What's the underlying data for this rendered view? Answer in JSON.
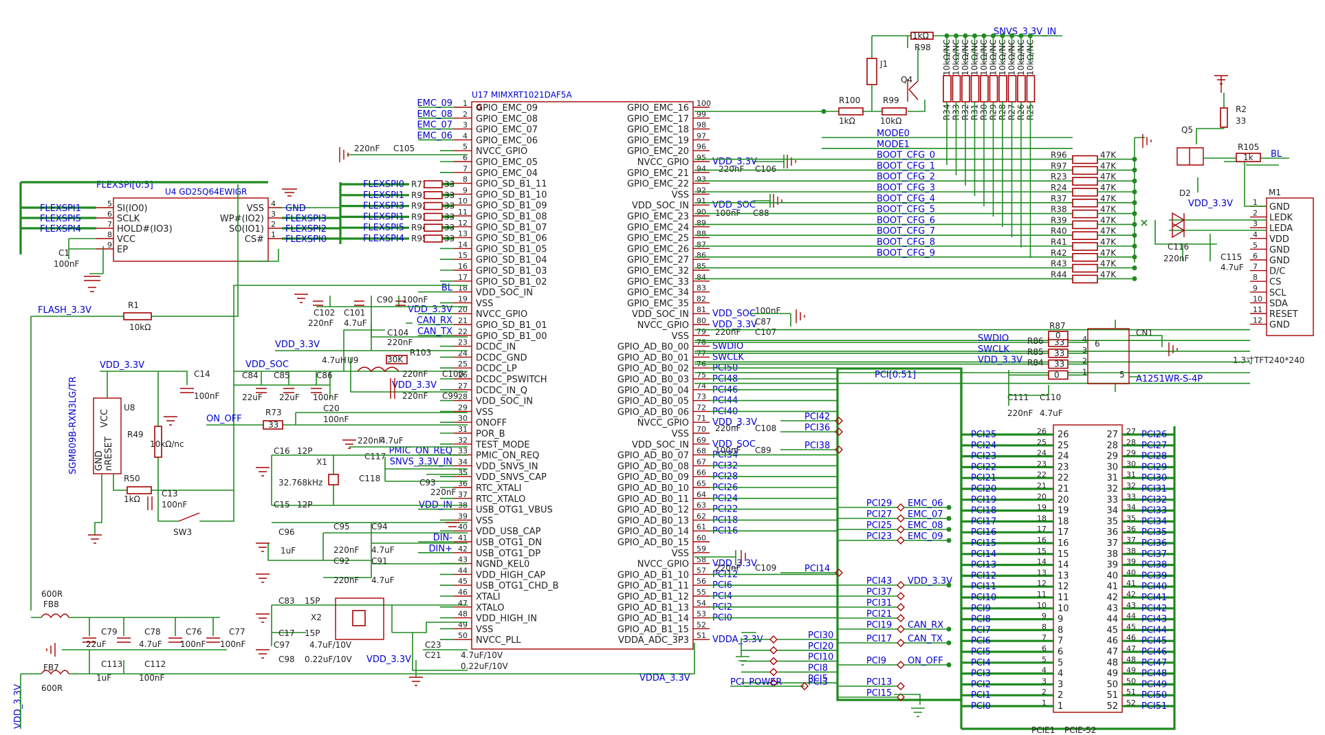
{
  "u17": {
    "name": "U17 MIMXRT1021DAF5A",
    "left": [
      {
        "n": "1",
        "s": "GPIO_EMC_09"
      },
      {
        "n": "2",
        "s": "GPIO_EMC_08"
      },
      {
        "n": "3",
        "s": "GPIO_EMC_07"
      },
      {
        "n": "4",
        "s": "GPIO_EMC_06"
      },
      {
        "n": "5",
        "s": "NVCC_GPIO"
      },
      {
        "n": "6",
        "s": "GPIO_EMC_05"
      },
      {
        "n": "7",
        "s": "GPIO_EMC_04"
      },
      {
        "n": "8",
        "s": "GPIO_SD_B1_11"
      },
      {
        "n": "9",
        "s": "GPIO_SD_B1_10"
      },
      {
        "n": "10",
        "s": "GPIO_SD_B1_09"
      },
      {
        "n": "11",
        "s": "GPIO_SD_B1_08"
      },
      {
        "n": "12",
        "s": "GPIO_SD_B1_07"
      },
      {
        "n": "13",
        "s": "GPIO_SD_B1_06"
      },
      {
        "n": "14",
        "s": "GPIO_SD_B1_05"
      },
      {
        "n": "15",
        "s": "GPIO_SD_B1_04"
      },
      {
        "n": "16",
        "s": "GPIO_SD_B1_03"
      },
      {
        "n": "17",
        "s": "GPIO_SD_B1_02"
      },
      {
        "n": "18",
        "s": "VDD_SOC_IN"
      },
      {
        "n": "19",
        "s": "VSS"
      },
      {
        "n": "20",
        "s": "NVCC_GPIO"
      },
      {
        "n": "21",
        "s": "GPIO_SD_B1_01"
      },
      {
        "n": "22",
        "s": "GPIO_SD_B1_00"
      },
      {
        "n": "23",
        "s": "DCDC_IN"
      },
      {
        "n": "24",
        "s": "DCDC_GND"
      },
      {
        "n": "25",
        "s": "DCDC_LP"
      },
      {
        "n": "26",
        "s": "DCDC_PSWITCH"
      },
      {
        "n": "27",
        "s": "DCDC_IN_Q"
      },
      {
        "n": "28",
        "s": "VDD_SOC_IN"
      },
      {
        "n": "29",
        "s": "VSS"
      },
      {
        "n": "30",
        "s": "ONOFF"
      },
      {
        "n": "31",
        "s": "POR_B"
      },
      {
        "n": "32",
        "s": "TEST_MODE"
      },
      {
        "n": "33",
        "s": "PMIC_ON_REQ"
      },
      {
        "n": "34",
        "s": "VDD_SNVS_IN"
      },
      {
        "n": "35",
        "s": "VDD_SNVS_CAP"
      },
      {
        "n": "36",
        "s": "RTC_XTALI"
      },
      {
        "n": "37",
        "s": "RTC_XTALO"
      },
      {
        "n": "38",
        "s": "USB_OTG1_VBUS"
      },
      {
        "n": "39",
        "s": "VSS"
      },
      {
        "n": "40",
        "s": "VDD_USB_CAP"
      },
      {
        "n": "41",
        "s": "USB_OTG1_DN"
      },
      {
        "n": "42",
        "s": "USB_OTG1_DP"
      },
      {
        "n": "43",
        "s": "NGND_KEL0"
      },
      {
        "n": "44",
        "s": "VDD_HIGH_CAP"
      },
      {
        "n": "45",
        "s": "USB_OTG1_CHD_B"
      },
      {
        "n": "46",
        "s": "XTALI"
      },
      {
        "n": "47",
        "s": "XTALO"
      },
      {
        "n": "48",
        "s": "VDD_HIGH_IN"
      },
      {
        "n": "49",
        "s": "VSS"
      },
      {
        "n": "50",
        "s": "NVCC_PLL"
      }
    ],
    "right": [
      {
        "n": "100",
        "s": "GPIO_EMC_16"
      },
      {
        "n": "99",
        "s": "GPIO_EMC_17"
      },
      {
        "n": "98",
        "s": "GPIO_EMC_18"
      },
      {
        "n": "97",
        "s": "GPIO_EMC_19"
      },
      {
        "n": "96",
        "s": "GPIO_EMC_20"
      },
      {
        "n": "95",
        "s": "NVCC_GPIO"
      },
      {
        "n": "94",
        "s": "GPIO_EMC_21"
      },
      {
        "n": "93",
        "s": "GPIO_EMC_22"
      },
      {
        "n": "92",
        "s": "VSS"
      },
      {
        "n": "91",
        "s": "VDD_SOC_IN"
      },
      {
        "n": "90",
        "s": "GPIO_EMC_23"
      },
      {
        "n": "89",
        "s": "GPIO_EMC_24"
      },
      {
        "n": "88",
        "s": "GPIO_EMC_25"
      },
      {
        "n": "87",
        "s": "GPIO_EMC_26"
      },
      {
        "n": "86",
        "s": "GPIO_EMC_27"
      },
      {
        "n": "85",
        "s": "GPIO_EMC_32"
      },
      {
        "n": "84",
        "s": "GPIO_EMC_33"
      },
      {
        "n": "83",
        "s": "GPIO_EMC_34"
      },
      {
        "n": "82",
        "s": "GPIO_EMC_35"
      },
      {
        "n": "81",
        "s": "VDD_SOC_IN"
      },
      {
        "n": "80",
        "s": "NVCC_GPIO"
      },
      {
        "n": "79",
        "s": "VSS"
      },
      {
        "n": "78",
        "s": "GPIO_AD_B0_00"
      },
      {
        "n": "77",
        "s": "GPIO_AD_B0_01"
      },
      {
        "n": "76",
        "s": "GPIO_AD_B0_02"
      },
      {
        "n": "75",
        "s": "GPIO_AD_B0_03"
      },
      {
        "n": "74",
        "s": "GPIO_AD_B0_04"
      },
      {
        "n": "73",
        "s": "GPIO_AD_B0_05"
      },
      {
        "n": "72",
        "s": "GPIO_AD_B0_06"
      },
      {
        "n": "71",
        "s": "NVCC_GPIO"
      },
      {
        "n": "70",
        "s": "VSS"
      },
      {
        "n": "69",
        "s": "VDD_SOC_IN"
      },
      {
        "n": "68",
        "s": "GPIO_AD_B0_07"
      },
      {
        "n": "67",
        "s": "GPIO_AD_B0_08"
      },
      {
        "n": "66",
        "s": "GPIO_AD_B0_09"
      },
      {
        "n": "65",
        "s": "GPIO_AD_B0_10"
      },
      {
        "n": "64",
        "s": "GPIO_AD_B0_11"
      },
      {
        "n": "63",
        "s": "GPIO_AD_B0_12"
      },
      {
        "n": "62",
        "s": "GPIO_AD_B0_13"
      },
      {
        "n": "61",
        "s": "GPIO_AD_B0_14"
      },
      {
        "n": "60",
        "s": "GPIO_AD_B0_15"
      },
      {
        "n": "59",
        "s": "VSS"
      },
      {
        "n": "58",
        "s": "NVCC_GPIO"
      },
      {
        "n": "57",
        "s": "GPIO_AD_B1_10"
      },
      {
        "n": "56",
        "s": "GPIO_AD_B1_11"
      },
      {
        "n": "55",
        "s": "GPIO_AD_B1_12"
      },
      {
        "n": "54",
        "s": "GPIO_AD_B1_13"
      },
      {
        "n": "53",
        "s": "GPIO_AD_B1_14"
      },
      {
        "n": "52",
        "s": "GPIO_AD_B1_15"
      },
      {
        "n": "51",
        "s": "VDDA_ADC_3P3"
      }
    ],
    "left_nets": {
      "1": "EMC_09",
      "2": "EMC_08",
      "3": "EMC_07",
      "4": "EMC_06",
      "18": "BL",
      "20": "VDD_3.3V",
      "21": "CAN_RX",
      "22": "CAN_TX",
      "33": "PMIC_ON_REQ",
      "34": "SNVS_3.3V_IN",
      "38": "VDD_IN",
      "41": "DIN-",
      "42": "DIN+"
    },
    "right_nets": {
      "95": "VDD_3.3V",
      "91": "VDD_SOC",
      "81": "VDD_SOC",
      "80": "VDD_3.3V",
      "78": "SWDIO",
      "77": "SWCLK",
      "76": "PCI50",
      "75": "PCI48",
      "74": "PCI46",
      "73": "PCI44",
      "72": "PCI40",
      "71": "VDD_3.3V",
      "69": "VDD_SOC",
      "68": "PCI34",
      "67": "PCI32",
      "66": "PCI28",
      "65": "PCI26",
      "64": "PCI24",
      "63": "PCI22",
      "62": "PCI18",
      "61": "PCI16",
      "58": "VDD_3.3V",
      "57": "PCI12",
      "56": "PCI6",
      "55": "PCI4",
      "54": "PCI2",
      "53": "PCI0",
      "51": "VDDA_3.3V"
    }
  },
  "u4": {
    "name": "U4 GD25Q64EWIGR",
    "bus": "FLEXSPI[0:5]",
    "left_pins": [
      {
        "n": "5",
        "s": "SI(IO0)"
      },
      {
        "n": "6",
        "s": "SCLK"
      },
      {
        "n": "7",
        "s": "HOLD#(IO3)"
      },
      {
        "n": "8",
        "s": "VCC"
      },
      {
        "n": "9",
        "s": "EP"
      }
    ],
    "right_pins": [
      {
        "n": "4",
        "s": "VSS"
      },
      {
        "n": "3",
        "s": "WP#(IO2)"
      },
      {
        "n": "2",
        "s": "SO(IO1)"
      },
      {
        "n": "1",
        "s": "CS#"
      }
    ],
    "left_nets": [
      "FLEXSPI1",
      "FLEXSPI5",
      "FLEXSPI4"
    ],
    "right_nets": [
      "GND",
      "FLEXSPI3",
      "FLEXSPI2",
      "FLEXSPI0"
    ]
  },
  "flexspi_res": [
    {
      "net": "FLEXSPI0",
      "ref": "R71",
      "val": "33",
      "pin": "8"
    },
    {
      "net": "FLEXSPI1",
      "ref": "R91",
      "val": "33",
      "pin": "9"
    },
    {
      "net": "FLEXSPI3",
      "ref": "R92",
      "val": "33",
      "pin": "10"
    },
    {
      "net": "FLEXSPI1",
      "ref": "R93",
      "val": "33",
      "pin": "11"
    },
    {
      "net": "FLEXSPI5",
      "ref": "R94",
      "val": "33",
      "pin": "12"
    },
    {
      "net": "FLEXSPI4",
      "ref": "R95",
      "val": "33",
      "pin": "13"
    }
  ],
  "boot": [
    {
      "net": "MODE0",
      "ref": "",
      "val": ""
    },
    {
      "net": "MODE1",
      "ref": "",
      "val": ""
    },
    {
      "net": "BOOT_CFG_0",
      "ref": "R96",
      "val": "47K"
    },
    {
      "net": "BOOT_CFG_1",
      "ref": "R97",
      "val": "47K"
    },
    {
      "net": "BOOT_CFG_2",
      "ref": "R23",
      "val": "47K"
    },
    {
      "net": "BOOT_CFG_3",
      "ref": "R24",
      "val": "47K"
    },
    {
      "net": "BOOT_CFG_4",
      "ref": "R37",
      "val": "47K"
    },
    {
      "net": "BOOT_CFG_5",
      "ref": "R38",
      "val": "47K"
    },
    {
      "net": "BOOT_CFG_6",
      "ref": "R39",
      "val": "47K"
    },
    {
      "net": "BOOT_CFG_7",
      "ref": "R40",
      "val": "47K"
    },
    {
      "net": "BOOT_CFG_8",
      "ref": "R41",
      "val": "47K"
    },
    {
      "net": "BOOT_CFG_9",
      "ref": "R42",
      "val": "47K"
    },
    {
      "net": "",
      "ref": "R43",
      "val": "47K"
    },
    {
      "net": "",
      "ref": "R44",
      "val": "47K"
    }
  ],
  "pullups": {
    "net": "SNVS_3.3V_IN",
    "refs": [
      "R34",
      "R33",
      "R32",
      "R31",
      "R30",
      "R29",
      "R28",
      "R27",
      "R26",
      "R25"
    ],
    "val": "10kΩ/NC",
    "r98": "R98",
    "r98_val": "1kΩ",
    "r100": "R100",
    "r100_val": "1kΩ",
    "r99": "R99",
    "r99_val": "10kΩ",
    "j1": "J1",
    "q4": "Q4"
  },
  "lcd": {
    "name": "M1",
    "pins": [
      {
        "n": "1",
        "s": "GND"
      },
      {
        "n": "2",
        "s": "LEDK"
      },
      {
        "n": "3",
        "s": "LEDA"
      },
      {
        "n": "4",
        "s": "VDD"
      },
      {
        "n": "5",
        "s": "GND"
      },
      {
        "n": "6",
        "s": "GND"
      },
      {
        "n": "7",
        "s": "D/C"
      },
      {
        "n": "8",
        "s": "CS"
      },
      {
        "n": "9",
        "s": "SCL"
      },
      {
        "n": "10",
        "s": "SDA"
      },
      {
        "n": "11",
        "s": "RESET"
      },
      {
        "n": "12",
        "s": "GND"
      }
    ],
    "caption": "1.3寸TFT240*240",
    "q5": "Q5",
    "r2": "R2",
    "r2_val": "33",
    "r105": "R105",
    "r105_val": "1k",
    "bl": "BL",
    "d2": "D2",
    "vdd": "VDD_3.3V",
    "c116": "C116",
    "c116_val": "220nF",
    "c115": "C115",
    "c115_val": "4.7uF"
  },
  "cn1": {
    "name": "CN1",
    "part": "A1251WR-S-4P",
    "rows": [
      {
        "net": "SWDIO",
        "ref": "R86",
        "val": "33",
        "pin": "4"
      },
      {
        "net": "SWCLK",
        "ref": "R85",
        "val": "33",
        "pin": "3"
      },
      {
        "net": "VDD_3.3V",
        "ref": "R84",
        "val": "33",
        "pin": "2"
      },
      {
        "net": "",
        "ref": "R87",
        "val": "0",
        "pin": "1"
      }
    ],
    "pins_r": [
      "6",
      "5"
    ],
    "caps": [
      {
        "ref": "C111",
        "val": "220nF"
      },
      {
        "ref": "C110",
        "val": "4.7uF"
      }
    ],
    "r87b": "0"
  },
  "pcie": {
    "name": "PCIE1",
    "part": "PCIE-52",
    "bus": "PCI[0:51]",
    "left": [
      "PCI25",
      "PCI24",
      "PCI23",
      "PCI22",
      "PCI21",
      "PCI20",
      "PCI19",
      "PCI18",
      "PCI17",
      "PCI16",
      "PCI15",
      "PCI14",
      "PCI13",
      "PCI12",
      "PCI11",
      "PCI10",
      "PCI9",
      "PCI8",
      "PCI7",
      "PCI6",
      "PCI5",
      "PCI4",
      "PCI3",
      "PCI2",
      "PCI1",
      "PCI0"
    ],
    "left_pins": [
      "26",
      "25",
      "24",
      "23",
      "22",
      "21",
      "20",
      "19",
      "18",
      "17",
      "16",
      "15",
      "14",
      "13",
      "12",
      "11",
      "10",
      "9",
      "8",
      "7",
      "6",
      "5",
      "4",
      "3",
      "2",
      "1"
    ],
    "right": [
      "PCI26",
      "PCI27",
      "PCI28",
      "PCI29",
      "PCI30",
      "PCI31",
      "PCI32",
      "PCI33",
      "PCI34",
      "PCI35",
      "PCI36",
      "PCI37",
      "PCI38",
      "PCI39",
      "PCI40",
      "PCI41",
      "PCI42",
      "PCI43",
      "PCI44",
      "PCI45",
      "PCI46",
      "PCI47",
      "PCI48",
      "PCI49",
      "PCI50",
      "PCI51"
    ],
    "right_pins": [
      "27",
      "28",
      "29",
      "30",
      "31",
      "32",
      "33",
      "34",
      "35",
      "36",
      "37",
      "38",
      "39",
      "40",
      "41",
      "42",
      "43",
      "44",
      "45",
      "46",
      "47",
      "48",
      "49",
      "50",
      "51",
      "52"
    ],
    "alias": [
      {
        "a": "PCI42",
        "b": ""
      },
      {
        "a": "PCI36",
        "b": ""
      },
      {
        "a": "PCI38",
        "b": ""
      },
      {
        "a": "PCI29",
        "b": "EMC_06"
      },
      {
        "a": "PCI27",
        "b": "EMC_07"
      },
      {
        "a": "PCI25",
        "b": "EMC_08"
      },
      {
        "a": "PCI23",
        "b": "EMC_09"
      },
      {
        "a": "PCI14",
        "b": ""
      },
      {
        "a": "PCI43",
        "b": "VDD_3.3V"
      },
      {
        "a": "PCI37",
        "b": ""
      },
      {
        "a": "PCI31",
        "b": ""
      },
      {
        "a": "PCI21",
        "b": ""
      },
      {
        "a": "PCI19",
        "b": "CAN_RX"
      },
      {
        "a": "PCI17",
        "b": "CAN_TX"
      },
      {
        "a": "PCI9",
        "b": "ON_OFF"
      },
      {
        "a": "PCI13",
        "b": ""
      },
      {
        "a": "PCI15",
        "b": ""
      }
    ],
    "gnd_alias": [
      "PCI30",
      "PCI20",
      "PCI10",
      "PCI8",
      "PCI5"
    ],
    "power_label": "PCI_POWER",
    "power_alias": "PCI3"
  },
  "power": {
    "flash": "FLASH_3.3V",
    "vdd": "VDD_3.3V",
    "vdd_soc": "VDD_SOC",
    "vdda": "VDDA_3.3V",
    "r1": "R1",
    "r1_val": "10kΩ",
    "c1": "C1",
    "c1_val": "100nF",
    "fb8": "FB8",
    "fb8_val": "600R",
    "fb7": "FB7",
    "fb7_val": "600R",
    "c105": "C105",
    "c105_val": "220nF",
    "c106": "C106",
    "c106_val": "220nF",
    "c88": "C88",
    "c88_val": "100nF",
    "c87": "C87",
    "c87_val": "100nF",
    "c107": "C107",
    "c107_val": "220nF",
    "c108": "C108",
    "c108_val": "220nF",
    "c89": "C89",
    "c89_val": "100nF",
    "c109": "C109",
    "c109_val": "220nF"
  },
  "left_side": {
    "u8": "U8",
    "u8_part": "SGM809B-RXN3LG/TR",
    "u8_pins": [
      "VCC",
      "GND",
      "nRESET"
    ],
    "r49": "R49",
    "r49_val": "10kΩ/nc",
    "r50": "R50",
    "r50_val": "1kΩ",
    "c13": "C13",
    "c13_val": "100nF",
    "sw3": "SW3",
    "c14": "C14",
    "c14_val": "100nF",
    "c84": "C84",
    "c84_val": "22uF",
    "c85": "C85",
    "c85_val": "22uF",
    "c86": "C86",
    "c86_val": "100nF",
    "c102": "C102",
    "c102_val": "220nF",
    "c101": "C101",
    "c101_val": "4.7uF",
    "c90": "C90",
    "c90_val": "100nF",
    "c104": "C104",
    "c104_val": "220nF",
    "u9": "U9",
    "u9_val": "4.7uH",
    "r103": "R103",
    "r103_val": "30K",
    "c100": "C100",
    "c100_val": "220nF",
    "c99": "C99",
    "c99_val": "220nF",
    "r73": "R73",
    "r73_val": "33",
    "c20": "C20",
    "c20_val": "100nF",
    "on_off": "ON_OFF",
    "c117": "C117",
    "c117_val": "220nF",
    "c117_val2": "4.7uF",
    "c118": "C118",
    "c93": "C93",
    "c93_val": "220nF",
    "c16": "C16",
    "c16_val": "12P",
    "c15": "C15",
    "c15_val": "12P",
    "x1": "X1",
    "x1_val": "32.768kHz",
    "c96": "C96",
    "c96_val": "1uF",
    "c95": "C95",
    "c95_val": "220nF",
    "c94": "C94",
    "c94_val": "4.7uF",
    "c92": "C92",
    "c92_val": "220nF",
    "c91": "C91",
    "c91_val": "4.7uF",
    "c83": "C83",
    "c83_val": "15P",
    "c17": "C17",
    "c17_val": "15P",
    "x2": "X2",
    "c97": "C97",
    "c97_val": "4.7uF/10V",
    "c98": "C98",
    "c98_val": "0.22uF/10V",
    "c23": "C23",
    "c21": "C21",
    "c23_val": "4.7uF/10V",
    "c21_val": "0.22uF/10V",
    "c79": "C79",
    "c79_val": "22uF",
    "c78": "C78",
    "c78_val": "4.7uF",
    "c76": "C76",
    "c76_val": "100nF",
    "c77": "C77",
    "c77_val": "100nF",
    "c113": "C113",
    "c113_val": "1uF",
    "c112": "C112",
    "c112_val": "100nF"
  }
}
